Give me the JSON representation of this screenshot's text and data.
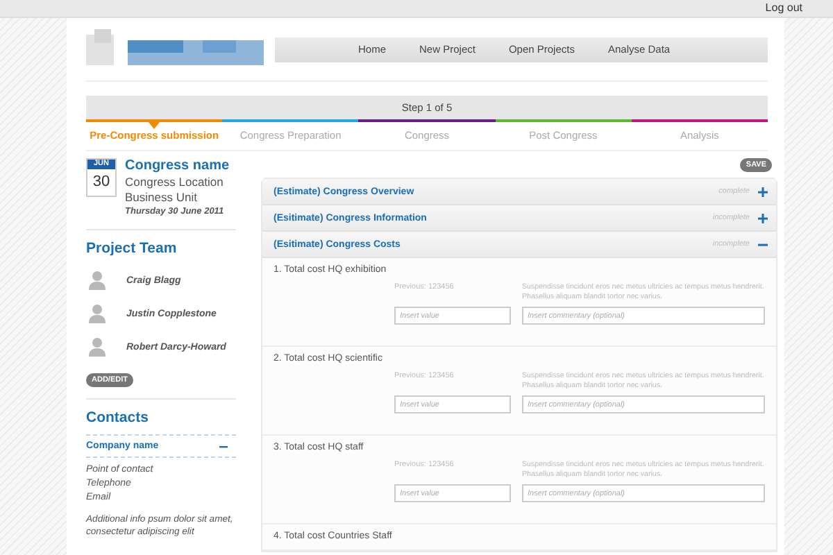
{
  "top_bar": {
    "logout": "Log out"
  },
  "nav": [
    "Home",
    "New Project",
    "Open Projects",
    "Analyse Data"
  ],
  "progress": {
    "step_label": "Step 1 of 5",
    "stages": [
      {
        "label": "Pre-Congress submission",
        "color": "#f08a00",
        "selected": true
      },
      {
        "label": "Congress Preparation",
        "color": "#1ea6e6",
        "selected": false
      },
      {
        "label": "Congress",
        "color": "#6b1f86",
        "selected": false
      },
      {
        "label": "Post Congress",
        "color": "#5cb82c",
        "selected": false
      },
      {
        "label": "Analysis",
        "color": "#c2177c",
        "selected": false
      }
    ]
  },
  "congress": {
    "month": "JUN",
    "day": "30",
    "name": "Congress name",
    "location": "Congress Location",
    "unit": "Business Unit",
    "date": "Thursday 30 June 2011"
  },
  "project_team": {
    "title": "Project Team",
    "members": [
      "Craig Blagg",
      "Justin Copplestone",
      "Robert Darcy-Howard"
    ],
    "action": "ADD/EDIT"
  },
  "contacts": {
    "title": "Contacts",
    "company": {
      "name": "Company name",
      "expanded": true,
      "lines": [
        "Point of contact",
        "Telephone",
        "Email"
      ],
      "info": "Additional info psum dolor sit amet, consectetur adipiscing elit"
    }
  },
  "save": "SAVE",
  "sections": [
    {
      "title": "(Estimate) Congress Overview",
      "status": "complete",
      "expanded": false
    },
    {
      "title": "(Esitimate) Congress Information",
      "status": "incomplete",
      "expanded": false
    },
    {
      "title": "(Esitimate) Congress Costs",
      "status": "incomplete",
      "expanded": true
    }
  ],
  "cost_items": [
    {
      "title": "1. Total cost HQ exhibition",
      "previous": "Previous: 123456",
      "note": "Suspendisse tincidunt eros nec metus ultricies ac tempus metus hendrerit. Phasellus aliquam blandit tortor nec varius.",
      "value_placeholder": "Insert value",
      "comment_placeholder": "Insert commentary (optional)"
    },
    {
      "title": "2. Total cost HQ scientific",
      "previous": "Previous: 123456",
      "note": "Suspendisse tincidunt eros nec metus ultricies ac tempus metus hendrerit. Phasellus aliquam blandit tortor nec varius.",
      "value_placeholder": "Insert value",
      "comment_placeholder": "Insert commentary (optional)"
    },
    {
      "title": "3. Total cost HQ staff",
      "previous": "Previous: 123456",
      "note": "Suspendisse tincidunt eros nec metus ultricies ac tempus metus hendrerit. Phasellus aliquam blandit tortor nec varius.",
      "value_placeholder": "Insert value",
      "comment_placeholder": "Insert commentary (optional)"
    },
    {
      "title": "4. Total cost Countries Staff"
    }
  ]
}
